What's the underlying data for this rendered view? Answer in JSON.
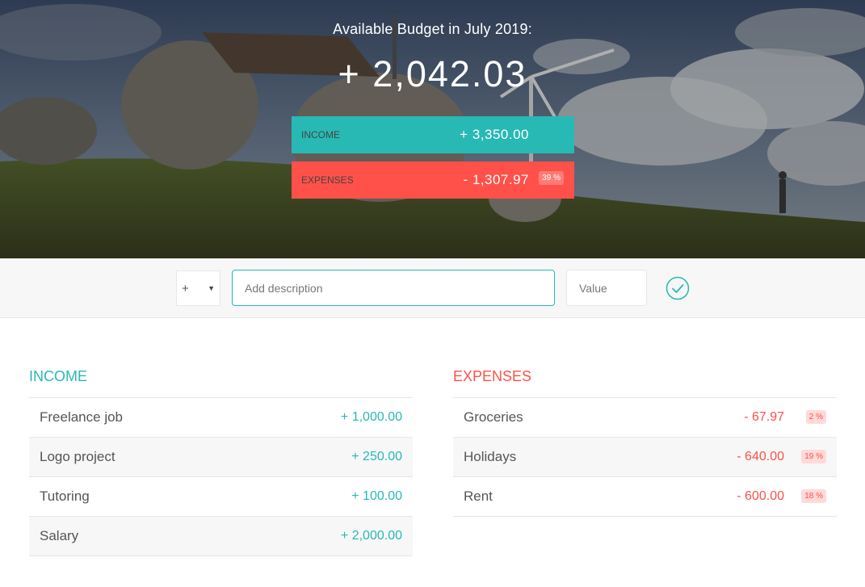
{
  "header": {
    "title": "Available Budget in July 2019:",
    "budget_value": "+ 2,042.03",
    "income": {
      "label": "Income",
      "value": "+ 3,350.00"
    },
    "expenses": {
      "label": "Expenses",
      "value": "- 1,307.97",
      "percentage": "39 %"
    }
  },
  "add_form": {
    "type_selected": "+",
    "type_options": [
      "+",
      "-"
    ],
    "description_placeholder": "Add description",
    "value_placeholder": "Value",
    "submit_icon": "check-circle-icon"
  },
  "income": {
    "title": "Income",
    "items": [
      {
        "description": "Freelance job",
        "value": "+ 1,000.00"
      },
      {
        "description": "Logo project",
        "value": "+ 250.00"
      },
      {
        "description": "Tutoring",
        "value": "+ 100.00"
      },
      {
        "description": "Salary",
        "value": "+ 2,000.00"
      }
    ]
  },
  "expenses": {
    "title": "Expenses",
    "items": [
      {
        "description": "Groceries",
        "value": "- 67.97",
        "percentage": "2 %"
      },
      {
        "description": "Holidays",
        "value": "- 640.00",
        "percentage": "19 %"
      },
      {
        "description": "Rent",
        "value": "- 600.00",
        "percentage": "18 %"
      }
    ]
  },
  "colors": {
    "income_accent": "#28B9B5",
    "expenses_accent": "#FF5049"
  }
}
